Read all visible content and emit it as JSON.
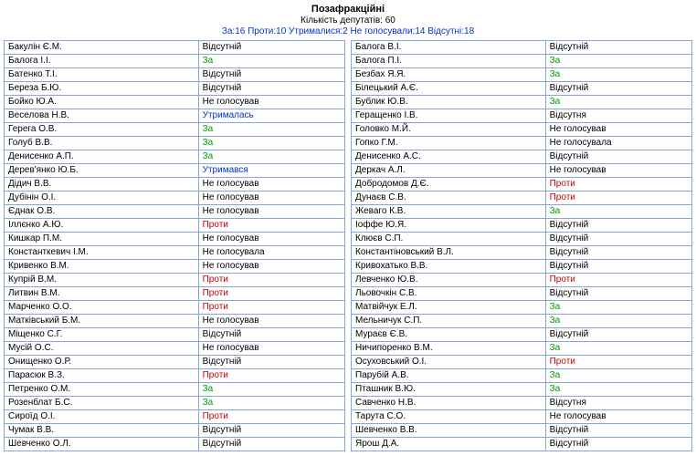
{
  "header": {
    "title": "Позафракційні",
    "subtitle": "Кількість депутатів: 60",
    "summary": "За:16 Проти:10 Утрималися:2 Не голосували:14 Відсутні:18"
  },
  "voteClass": {
    "За": "v-for",
    "Проти": "v-against",
    "Утримався": "v-abstain",
    "Утрималась": "v-abstain",
    "Не голосував": "v-novote",
    "Не голосувала": "v-novote",
    "Відсутній": "v-absent",
    "Відсутня": "v-absent"
  },
  "left": [
    {
      "name": "Бакулін Є.М.",
      "vote": "Відсутній"
    },
    {
      "name": "Балога І.І.",
      "vote": "За"
    },
    {
      "name": "Батенко Т.І.",
      "vote": "Відсутній"
    },
    {
      "name": "Береза Б.Ю.",
      "vote": "Відсутній"
    },
    {
      "name": "Бойко Ю.А.",
      "vote": "Не голосував"
    },
    {
      "name": "Веселова Н.В.",
      "vote": "Утрималась"
    },
    {
      "name": "Герега О.В.",
      "vote": "За"
    },
    {
      "name": "Голуб В.В.",
      "vote": "За"
    },
    {
      "name": "Денисенко А.П.",
      "vote": "За"
    },
    {
      "name": "Дерев'янко Ю.Б.",
      "vote": "Утримався"
    },
    {
      "name": "Дідич В.В.",
      "vote": "Не голосував"
    },
    {
      "name": "Дубінін О.І.",
      "vote": "Не голосував"
    },
    {
      "name": "Єднак О.В.",
      "vote": "Не голосував"
    },
    {
      "name": "Іллєнко А.Ю.",
      "vote": "Проти"
    },
    {
      "name": "Кишкар П.М.",
      "vote": "Не голосував"
    },
    {
      "name": "Константкевич І.М.",
      "vote": "Не голосувала"
    },
    {
      "name": "Кривенко В.М.",
      "vote": "Не голосував"
    },
    {
      "name": "Купрій В.М.",
      "vote": "Проти"
    },
    {
      "name": "Литвин В.М.",
      "vote": "Проти"
    },
    {
      "name": "Марченко О.О.",
      "vote": "Проти"
    },
    {
      "name": "Матківський Б.М.",
      "vote": "Не голосував"
    },
    {
      "name": "Міщенко С.Г.",
      "vote": "Відсутній"
    },
    {
      "name": "Мусій О.С.",
      "vote": "Не голосував"
    },
    {
      "name": "Онищенко О.Р.",
      "vote": "Відсутній"
    },
    {
      "name": "Парасюк В.З.",
      "vote": "Проти"
    },
    {
      "name": "Петренко О.М.",
      "vote": "За"
    },
    {
      "name": "Розенблат Б.С.",
      "vote": "За"
    },
    {
      "name": "Сироїд О.І.",
      "vote": "Проти"
    },
    {
      "name": "Чумак В.В.",
      "vote": "Відсутній"
    },
    {
      "name": "Шевченко О.Л.",
      "vote": "Відсутній"
    }
  ],
  "right": [
    {
      "name": "Балога В.І.",
      "vote": "Відсутній"
    },
    {
      "name": "Балога П.І.",
      "vote": "За"
    },
    {
      "name": "Безбах Я.Я.",
      "vote": "За"
    },
    {
      "name": "Білецький А.Є.",
      "vote": "Відсутній"
    },
    {
      "name": "Бублик Ю.В.",
      "vote": "За"
    },
    {
      "name": "Геращенко І.В.",
      "vote": "Відсутня"
    },
    {
      "name": "Головко М.Й.",
      "vote": "Не голосував"
    },
    {
      "name": "Гопко Г.М.",
      "vote": "Не голосувала"
    },
    {
      "name": "Денисенко А.С.",
      "vote": "Відсутній"
    },
    {
      "name": "Деркач А.Л.",
      "vote": "Не голосував"
    },
    {
      "name": "Добродомов Д.Є.",
      "vote": "Проти"
    },
    {
      "name": "Дунаєв С.В.",
      "vote": "Проти"
    },
    {
      "name": "Жеваго К.В.",
      "vote": "За"
    },
    {
      "name": "Іоффе Ю.Я.",
      "vote": "Відсутній"
    },
    {
      "name": "Клюєв С.П.",
      "vote": "Відсутній"
    },
    {
      "name": "Константіновський В.Л.",
      "vote": "Відсутній"
    },
    {
      "name": "Кривохатько В.В.",
      "vote": "Відсутній"
    },
    {
      "name": "Левченко Ю.В.",
      "vote": "Проти"
    },
    {
      "name": "Льовочкін С.В.",
      "vote": "Відсутній"
    },
    {
      "name": "Матвійчук Е.Л.",
      "vote": "За"
    },
    {
      "name": "Мельничук С.П.",
      "vote": "За"
    },
    {
      "name": "Мураєв Є.В.",
      "vote": "Відсутній"
    },
    {
      "name": "Ничипоренко В.М.",
      "vote": "За"
    },
    {
      "name": "Осуховський О.І.",
      "vote": "Проти"
    },
    {
      "name": "Парубій А.В.",
      "vote": "За"
    },
    {
      "name": "Пташник В.Ю.",
      "vote": "За"
    },
    {
      "name": "Савченко Н.В.",
      "vote": "Відсутня"
    },
    {
      "name": "Тарута С.О.",
      "vote": "Не голосував"
    },
    {
      "name": "Шевченко В.В.",
      "vote": "Відсутній"
    },
    {
      "name": "Ярош Д.А.",
      "vote": "Відсутній"
    }
  ]
}
